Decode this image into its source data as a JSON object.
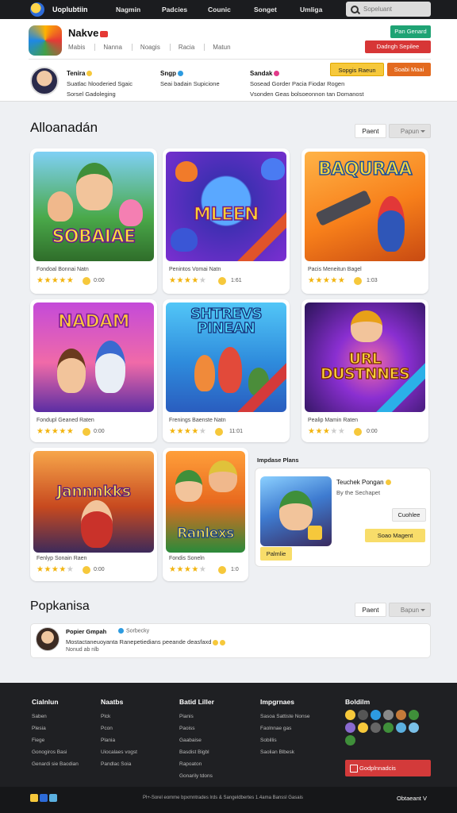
{
  "nav": {
    "brand": "Uoplubtiin",
    "links": [
      "Nagmin",
      "Padcies",
      "Counic",
      "Songet",
      "Umliga"
    ],
    "search_placeholder": "Sopeluant"
  },
  "profile": {
    "name": "Nakve",
    "tabs": [
      "Mabis",
      "Nanna",
      "Noagis",
      "Racia",
      "Matun"
    ],
    "btn_green": "Pan Genard",
    "btn_red": "Dadngh Sepilee",
    "stats": [
      {
        "head": "Tenira",
        "lines": [
          "Suatlac hlooderied Sgaic",
          "Sorsel Gadoleging"
        ]
      },
      {
        "head": "Sngp",
        "lines": [
          "Seai badain Supicione"
        ]
      },
      {
        "head": "Sandak",
        "lines": [
          "Sosead Gorder Pacia Fiodar Rogen",
          "Vsonden Geas bolsoeonnon tan Domanost"
        ]
      }
    ],
    "btn_yellow": "Sopgis Raeun",
    "btn_orange": "Soabi Maai"
  },
  "games_section": {
    "title": "Alloanadán",
    "sort_a": "Paent",
    "sort_b": "Papun"
  },
  "games": [
    {
      "thumb_title": "SOBAIAE",
      "name": "Fondoal Bonnai Natn",
      "rating": "0:00",
      "stars": 4.5
    },
    {
      "thumb_title": "MLEEN",
      "name": "Penintos Vomai Natn",
      "rating": "1:61",
      "stars": 4
    },
    {
      "thumb_title": "BAQURAA",
      "name": "Pacis Meneitun Bagel",
      "rating": "1:03",
      "stars": 4.5
    },
    {
      "thumb_title": "NADAM",
      "name": "Fondupl Geaned Raten",
      "rating": "0:00",
      "stars": 4.5
    },
    {
      "thumb_title": "SHTREVS PINEAN",
      "name": "Frenings Baenste Natn",
      "rating": "11:01",
      "stars": 4
    },
    {
      "thumb_title": "URL DUSTNNES",
      "name": "Pealip Mamin Raten",
      "rating": "0:00",
      "stars": 3.5
    },
    {
      "thumb_title": "Jannnkks",
      "name": "Fenlyp Sonain Raen",
      "rating": "0:00",
      "stars": 3.5
    },
    {
      "thumb_title": "Ranlexs",
      "name": "Fondis Soneln",
      "rating": "1:0",
      "stars": 4
    }
  ],
  "featured": {
    "label": "Impdase Plans",
    "name": "Teuchek Pongan",
    "sub": "By the Sechapet",
    "btn1": "Cuohlee",
    "btn2": "Soao Magent",
    "btn3": "Palmlie"
  },
  "comments_section": {
    "title": "Popkanisa",
    "sort_a": "Paent",
    "sort_b": "Bapun"
  },
  "comment": {
    "name": "Popier Gmpah",
    "time": "Sorbecky",
    "body": "Mostactaneuoyanta Ranepetiedians peeande deasfaxd",
    "reply": "Nonud ab nlb"
  },
  "footer": {
    "cols": [
      {
        "head": "Cialnlun",
        "items": [
          "Saben",
          "Plesia",
          "Fiege",
          "Gonogiros Basi",
          "Genardi sie Baodian"
        ]
      },
      {
        "head": "Naatbs",
        "items": [
          "Plck",
          "Pcon",
          "Plania",
          "Uiocalaes vogst",
          "Pandlac Soia"
        ]
      },
      {
        "head": "Batid Liller",
        "items": [
          "Pianis",
          "Paoiss",
          "Gaabaise",
          "Basdist Bigbl",
          "Rapoaton",
          "Gonarily tdons"
        ]
      },
      {
        "head": "Impgrnaes",
        "items": [
          "Sasoa Sattiste Nonse",
          "Faolnnae gas",
          "Sobillis",
          "Saolian Blbesk"
        ]
      }
    ],
    "social_head": "Boldilm",
    "red_button": "Godplnnadcis",
    "copyright": "Pl+-Sorel eomme bpxmntrades lrds & Sangeldbertes 1.4ama Banssl Gasais",
    "lang": "Obtaeant V"
  },
  "colors": {
    "accent_red": "#d73636",
    "accent_green": "#1fa374",
    "accent_yellow": "#f6c83b",
    "star": "#f2b40f"
  }
}
